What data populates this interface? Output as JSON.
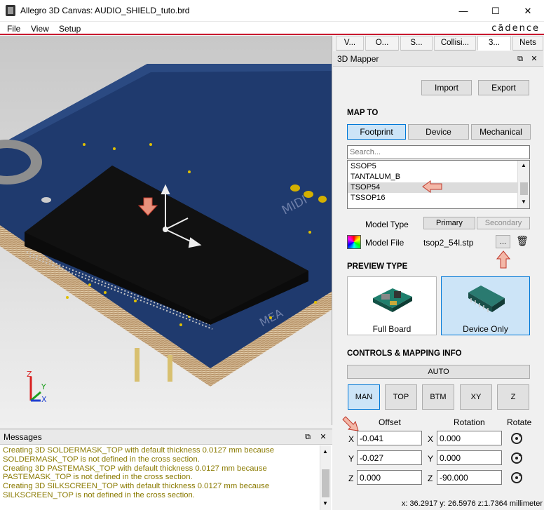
{
  "window": {
    "title": "Allegro 3D Canvas: AUDIO_SHIELD_tuto.brd",
    "minimize": "—",
    "maximize": "☐",
    "close": "✕"
  },
  "menu": {
    "items": [
      "File",
      "View",
      "Setup"
    ],
    "brand": "cādence"
  },
  "viewport": {
    "board_text": [
      "MIDI",
      "MEA"
    ],
    "axes": {
      "z": "Z",
      "y": "Y",
      "x": "X"
    }
  },
  "messages": {
    "title": "Messages",
    "lines": [
      "Creating 3D SOLDERMASK_TOP with default thickness 0.0127 mm because",
      "SOLDERMASK_TOP is not defined in the cross section.",
      "Creating 3D PASTEMASK_TOP with default thickness 0.0127 mm because",
      "PASTEMASK_TOP is not defined in the cross section.",
      "Creating 3D SILKSCREEN_TOP with default thickness 0.0127 mm because",
      "SILKSCREEN_TOP is not defined in the cross section."
    ]
  },
  "tabs": [
    "V...",
    "O...",
    "S...",
    "Collisi...",
    "3...",
    "Nets"
  ],
  "mapper": {
    "title": "3D Mapper",
    "import_label": "Import",
    "export_label": "Export",
    "map_to_title": "MAP TO",
    "map_to": [
      "Footprint",
      "Device",
      "Mechanical"
    ],
    "search_placeholder": "Search...",
    "list_items": [
      "SSOP5",
      "TANTALUM_B",
      "TSOP54",
      "TSSOP16"
    ],
    "selected_item": "TSOP54",
    "model_type_label": "Model Type",
    "primary_label": "Primary",
    "secondary_label": "Secondary",
    "model_file_label": "Model File",
    "model_file_value": "tsop2_54l.stp",
    "browse_label": "...",
    "preview_type_title": "PREVIEW TYPE",
    "preview_full": "Full Board",
    "preview_device": "Device Only",
    "controls_title": "CONTROLS & MAPPING INFO",
    "auto_label": "AUTO",
    "views": [
      "MAN",
      "TOP",
      "BTM",
      "XY",
      "Z"
    ],
    "offset_header": "Offset",
    "rotation_header": "Rotation",
    "rotate_header": "Rotate",
    "rows": [
      {
        "axis": "X",
        "offset": "-0.041",
        "rotation": "0.000"
      },
      {
        "axis": "Y",
        "offset": "-0.027",
        "rotation": "0.000"
      },
      {
        "axis": "Z",
        "offset": "0.000",
        "rotation": "-90.000"
      }
    ],
    "status": "x: 36.2917 y: 26.5976 z:1.7364 millimeter"
  },
  "colors": {
    "accent_red": "#c8102e",
    "selection_blue": "#cce4f7",
    "board_blue": "#1f3a6e",
    "message_text": "#8a7a00"
  }
}
